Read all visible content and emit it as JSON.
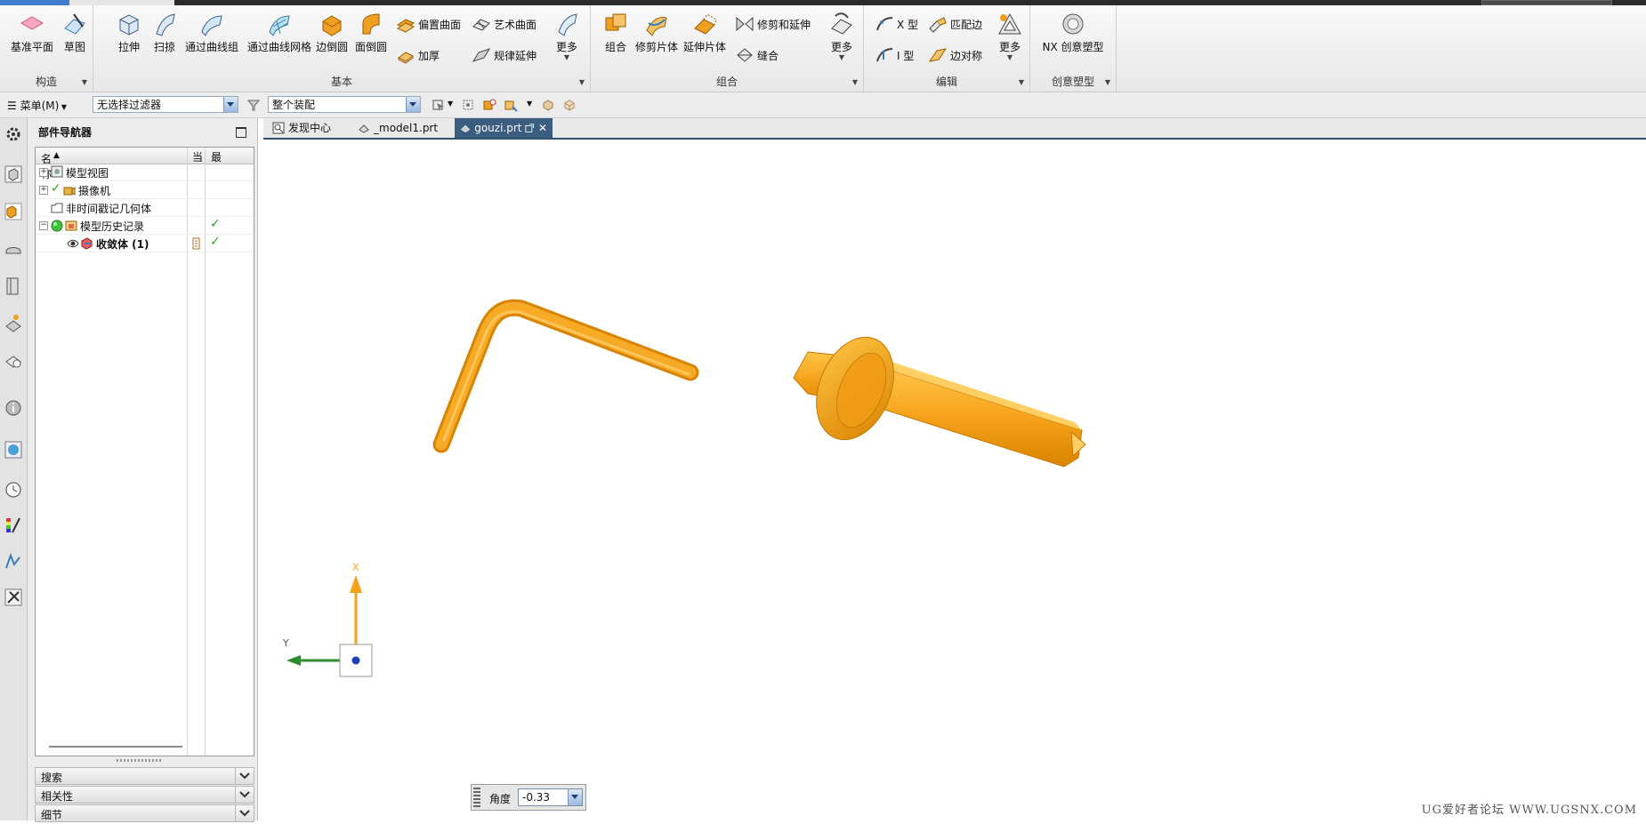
{
  "ribbon": {
    "groups": {
      "construct": {
        "label": "构造",
        "buttons": [
          "基准平面",
          "草图"
        ]
      },
      "basic": {
        "label": "基本",
        "buttons": [
          "拉伸",
          "扫掠",
          "通过曲线组",
          "通过曲线网格",
          "边倒圆",
          "面倒圆",
          "更多"
        ],
        "small_buttons": [
          "偏置曲面",
          "艺术曲面",
          "加厚",
          "规律延伸"
        ]
      },
      "combine": {
        "label": "组合",
        "buttons": [
          "组合",
          "修剪片体",
          "延伸片体",
          "更多"
        ],
        "small_buttons": [
          "修剪和延伸",
          "缝合"
        ]
      },
      "edit": {
        "label": "编辑",
        "buttons": [
          "更多"
        ],
        "small_buttons": [
          "X 型",
          "匹配边",
          "I 型",
          "边对称"
        ]
      },
      "creative": {
        "label": "创意塑型",
        "buttons": [
          "NX 创意塑型"
        ]
      }
    }
  },
  "selection_bar": {
    "menu_label": "菜单(M)",
    "filter_value": "无选择过滤器",
    "scope_value": "整个装配"
  },
  "navigator": {
    "title": "部件导航器",
    "columns": [
      "名称",
      "当",
      "最"
    ],
    "rows": [
      {
        "label": "模型视图"
      },
      {
        "label": "摄像机"
      },
      {
        "label": "非时间戳记几何体"
      },
      {
        "label": "模型历史记录"
      },
      {
        "label": "收敛体 (1)"
      }
    ],
    "sections": [
      "搜索",
      "相关性",
      "细节"
    ]
  },
  "tabs": [
    {
      "label": "发现中心"
    },
    {
      "label": "_model1.prt"
    },
    {
      "label": "gouzi.prt"
    }
  ],
  "viewport": {
    "axis_x": "X",
    "axis_y": "Y",
    "angle_label": "角度",
    "angle_value": "-0.33",
    "watermark": "UG爱好者论坛 WWW.UGSNX.COM"
  },
  "colors": {
    "model": "#f5a21b",
    "axis_x": "#f5a21b",
    "axis_y": "#2e8b2e",
    "active_tab": "#3b5d80"
  }
}
